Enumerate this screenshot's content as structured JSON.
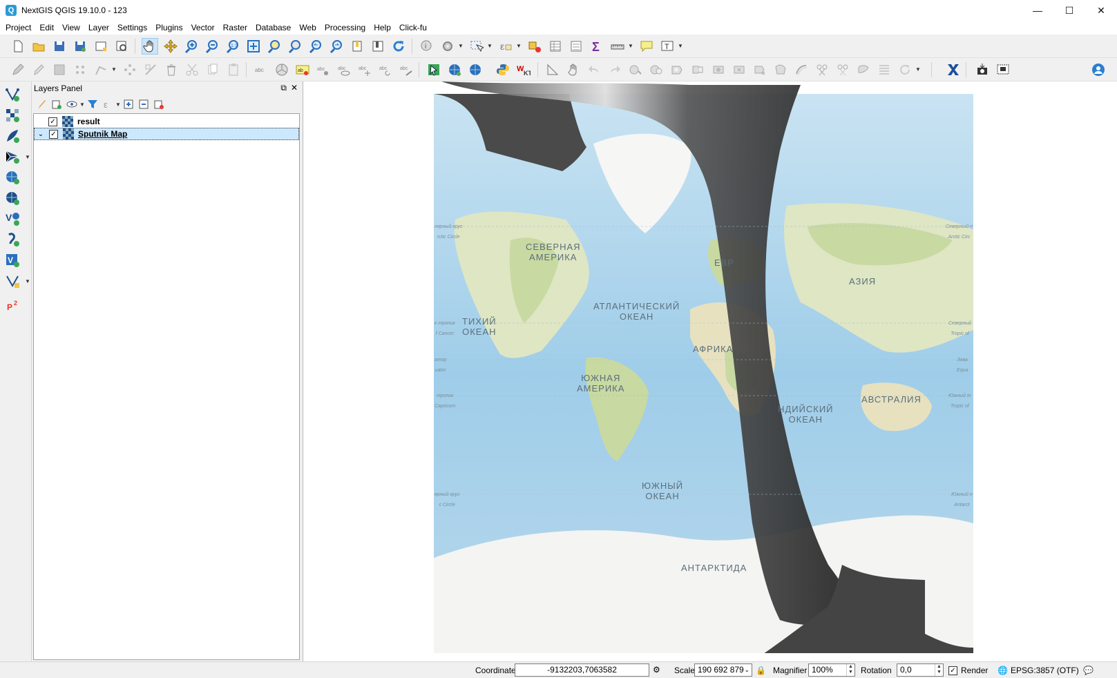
{
  "window": {
    "title": "NextGIS QGIS 19.10.0 - 123",
    "icon": "qgis-logo-icon"
  },
  "menu": [
    "Project",
    "Edit",
    "View",
    "Layer",
    "Settings",
    "Plugins",
    "Vector",
    "Raster",
    "Database",
    "Web",
    "Processing",
    "Help",
    "Click-fu"
  ],
  "layers_panel": {
    "title": "Layers Panel",
    "layers": [
      {
        "name": "result",
        "checked": true,
        "selected": false,
        "expandable": false
      },
      {
        "name": "Sputnik Map",
        "checked": true,
        "selected": true,
        "expandable": true
      }
    ]
  },
  "map": {
    "labels": {
      "north_america": "СЕВЕРНАЯ\nАМЕРИКА",
      "pacific": "ТИХИЙ\nОКЕАН",
      "atlantic": "АТЛАНТИЧЕСКИЙ\nОКЕАН",
      "south_america": "ЮЖНАЯ\nАМЕРИКА",
      "southern_ocean": "ЮЖНЫЙ\nОКЕАН",
      "antarctica": "АНТАРКТИДА",
      "africa": "АФРИКА",
      "europe": "ЕВР",
      "asia": "АЗИЯ",
      "indian_ocean": "НДИЙСКИЙ\nОКЕАН",
      "australia": "АВСТРАЛИЯ",
      "arctic_circle_left": "лярный круг\nrctic Circle",
      "arctic_circle_right": "Северный п\nArctic Circ",
      "tropic_cancer_left": "к тропик\nf Cancer",
      "tropic_cancer_right": "Северный\nTropic of",
      "equator_left": "атор\nuator",
      "equator_right": "Эква\nEqua",
      "tropic_capricorn_left": "тропик\nCapricorn",
      "tropic_capricorn_right": "Южный т\nTropic of",
      "antarctic_circle_left": "ярный круг\nc Circle",
      "antarctic_circle_right": "Южный п\nAntarct"
    }
  },
  "status": {
    "coordinate_label": "Coordinate",
    "coordinate_value": "-9132203,7063582",
    "scale_label": "Scale",
    "scale_value": "190 692 879",
    "magnifier_label": "Magnifier",
    "magnifier_value": "100%",
    "rotation_label": "Rotation",
    "rotation_value": "0,0",
    "render_label": "Render",
    "render_checked": true,
    "crs": "EPSG:3857 (OTF)"
  }
}
